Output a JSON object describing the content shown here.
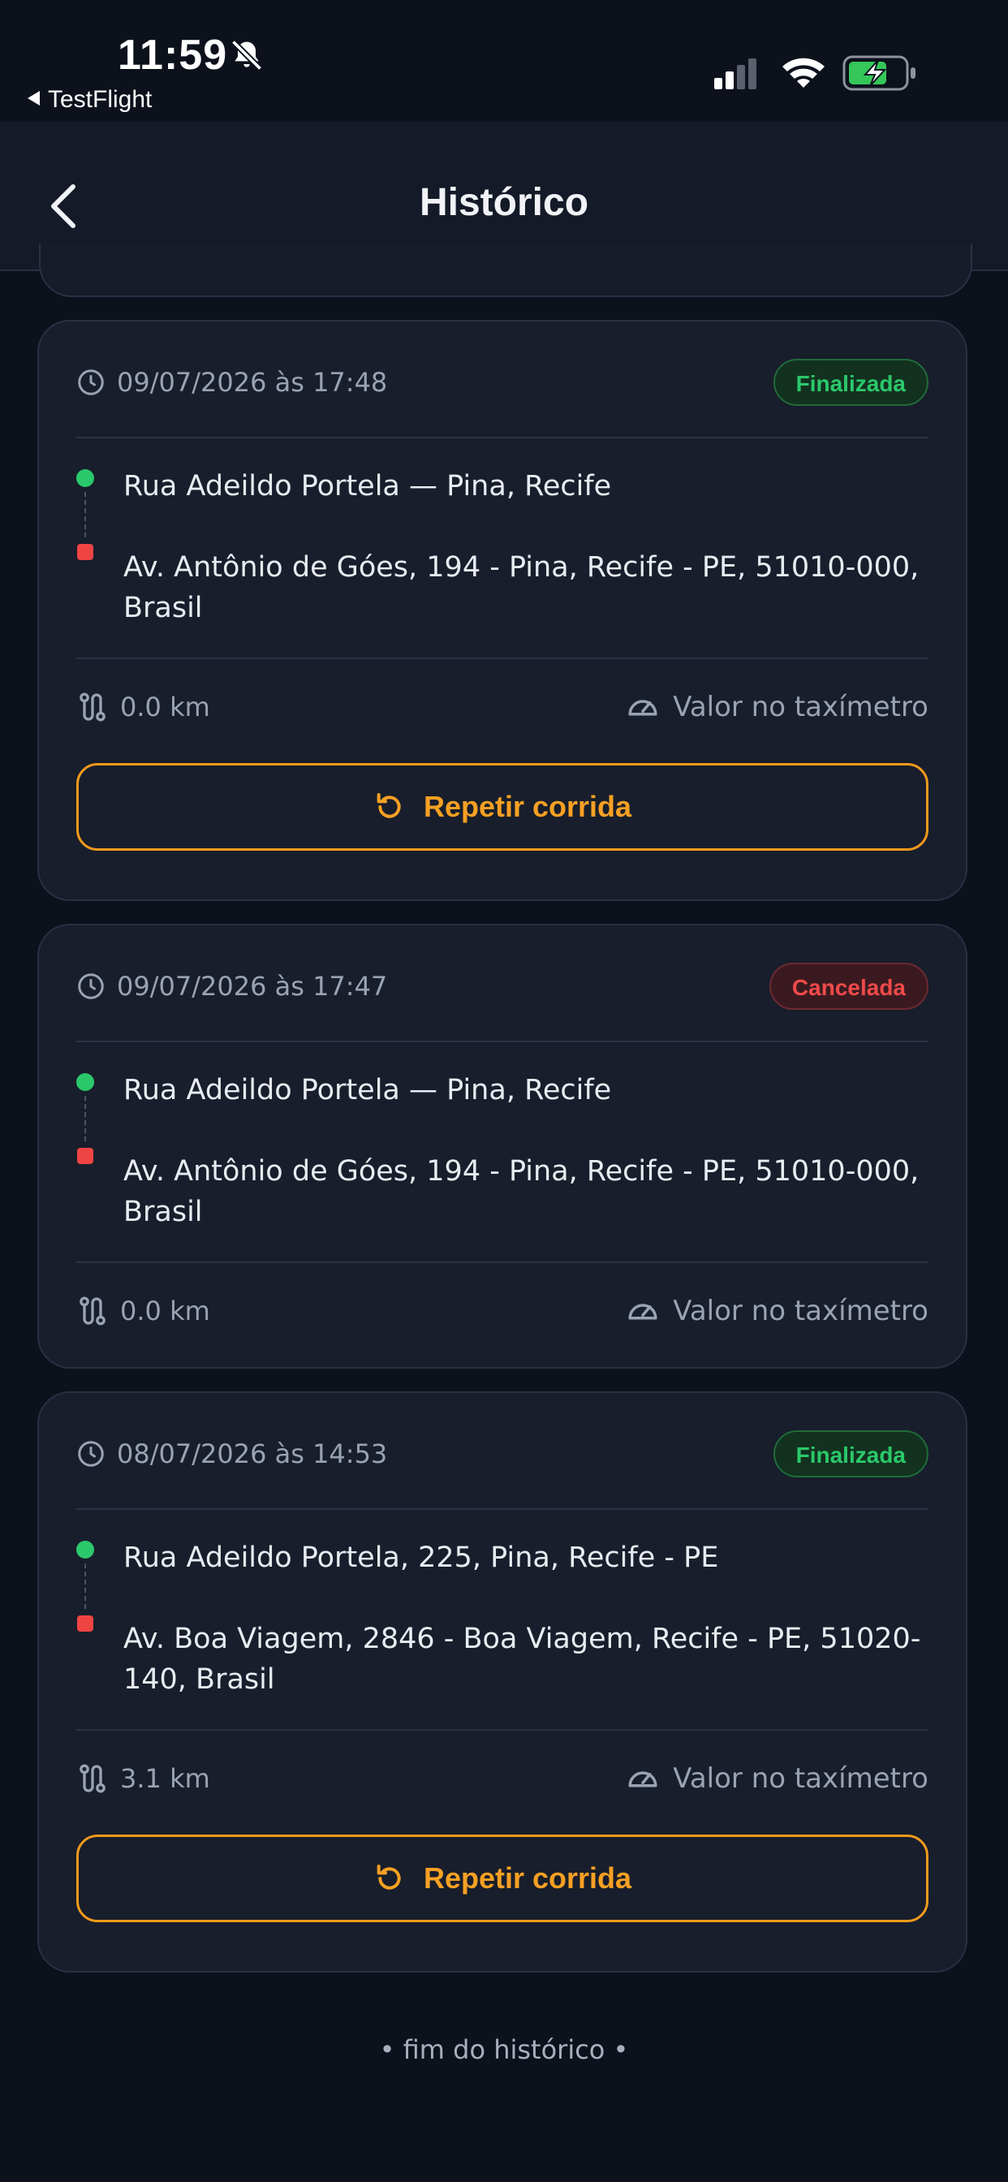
{
  "status_bar": {
    "time": "11:59",
    "back_app": "TestFlight"
  },
  "header": {
    "title": "Histórico"
  },
  "rides": [
    {
      "datetime": "09/07/2026 às 17:48",
      "status": "Finalizada",
      "origin": "Rua Adeildo Portela — Pina, Recife",
      "destination": "Av. Antônio de Góes, 194 - Pina, Recife - PE, 51010-000, Brasil",
      "distance": "0.0 km",
      "fare": "Valor no taxímetro",
      "repeat_label": "Repetir corrida"
    },
    {
      "datetime": "09/07/2026 às 17:47",
      "status": "Cancelada",
      "origin": "Rua Adeildo Portela — Pina, Recife",
      "destination": "Av. Antônio de Góes, 194 - Pina, Recife - PE, 51010-000, Brasil",
      "distance": "0.0 km",
      "fare": "Valor no taxímetro"
    },
    {
      "datetime": "08/07/2026 às 14:53",
      "status": "Finalizada",
      "origin": "Rua Adeildo Portela, 225, Pina, Recife - PE",
      "destination": "Av. Boa Viagem, 2846 - Boa Viagem, Recife - PE, 51020-140, Brasil",
      "distance": "3.1 km",
      "fare": "Valor no taxímetro",
      "repeat_label": "Repetir corrida"
    }
  ],
  "footer": {
    "end_label": "• fim do histórico •"
  },
  "colors": {
    "finalized": "#2bc86b",
    "cancelled": "#ef4a4a",
    "accent": "#f39a1b",
    "background": "#0c111c"
  }
}
